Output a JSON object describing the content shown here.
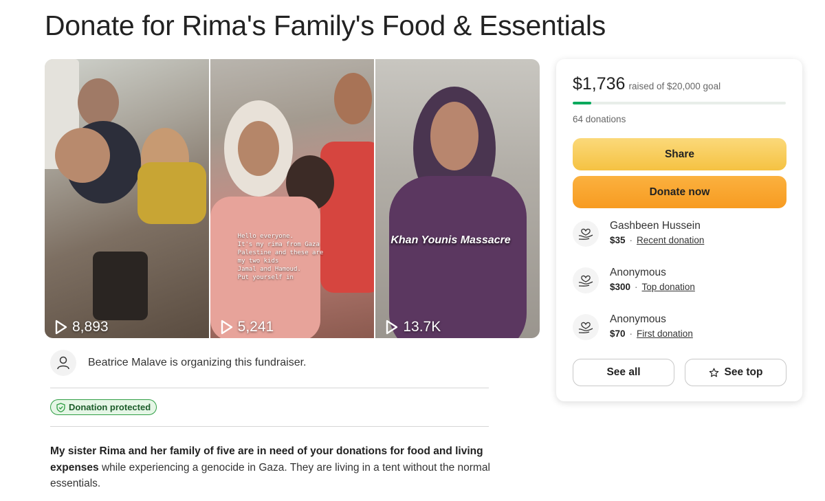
{
  "page": {
    "title": "Donate for Rima's Family's Food & Essentials"
  },
  "media": [
    {
      "views": "8,893"
    },
    {
      "views": "5,241",
      "caption": "Hello everyone.\nIt's my rima from Gaza\nPalestine and these are\nmy two kids\nJamal and Hamoud.\nPut yourself in"
    },
    {
      "views": "13.7K",
      "overlay_title": "Khan Younis Massacre"
    }
  ],
  "organizer": {
    "text": "Beatrice Malave is organizing this fundraiser."
  },
  "badge": {
    "label": "Donation protected"
  },
  "story": {
    "bold": "My sister Rima and her family of five are in need of your donations for food and living expenses",
    "rest": " while experiencing a genocide in Gaza. They are living in a tent without the normal essentials."
  },
  "card": {
    "raised": "$1,736",
    "goal_text": "raised of $20,000 goal",
    "progress_fraction": 0.0868,
    "donation_count": "64 donations",
    "share_label": "Share",
    "donate_label": "Donate now",
    "donors": [
      {
        "name": "Gashbeen Hussein",
        "amount": "$35",
        "tag": "Recent donation"
      },
      {
        "name": "Anonymous",
        "amount": "$300",
        "tag": "Top donation"
      },
      {
        "name": "Anonymous",
        "amount": "$70",
        "tag": "First donation"
      }
    ],
    "see_all_label": "See all",
    "see_top_label": "See top"
  },
  "colors": {
    "progress": "#02a95c",
    "share_button": "#f5c242",
    "donate_button": "#f79b21",
    "badge_border": "#2f9e44"
  },
  "icons": {
    "play": "play-icon",
    "avatar": "user-icon",
    "shield": "shield-check-icon",
    "donor": "heart-hand-icon",
    "star": "star-icon"
  }
}
